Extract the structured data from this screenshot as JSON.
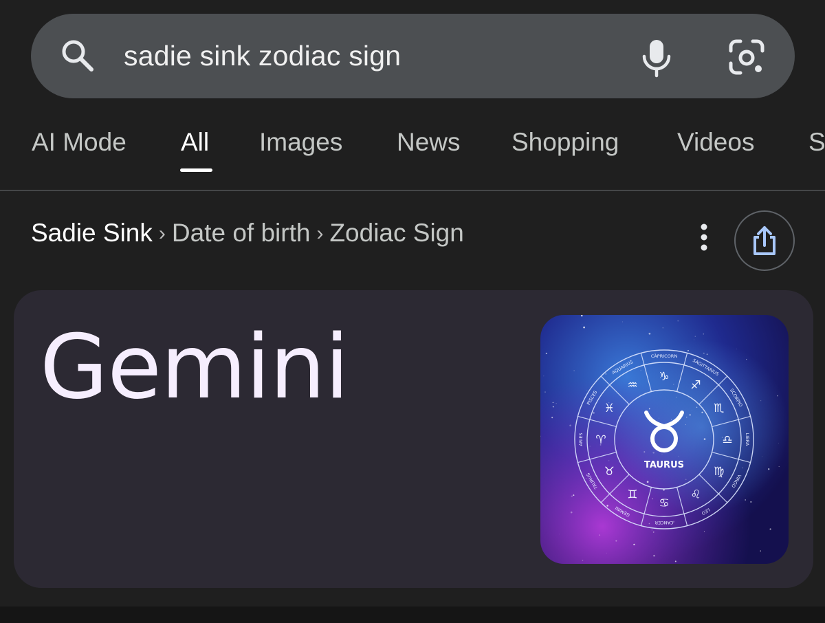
{
  "search": {
    "query": "sadie sink zodiac sign",
    "icons": [
      "search-icon",
      "microphone-icon",
      "camera-lens-icon"
    ]
  },
  "tabs": [
    {
      "label": "AI Mode",
      "active": false
    },
    {
      "label": "All",
      "active": true
    },
    {
      "label": "Images",
      "active": false
    },
    {
      "label": "News",
      "active": false
    },
    {
      "label": "Shopping",
      "active": false
    },
    {
      "label": "Videos",
      "active": false
    },
    {
      "label": "S",
      "active": false
    }
  ],
  "breadcrumb": {
    "entity": "Sadie Sink",
    "separator": "›",
    "step1": "Date of birth",
    "step2": "Zodiac Sign"
  },
  "answer": {
    "value": "Gemini",
    "image": {
      "center_label": "TAURUS",
      "ring_labels": [
        "CAPRICORN",
        "SAGITTARIUS",
        "SCORPIO",
        "LIBRA",
        "VIRGO",
        "LEO",
        "CANCER",
        "GEMINI",
        "TAURUS",
        "ARIES",
        "PISCES",
        "AQUARIUS"
      ],
      "ring_symbols": [
        "♑",
        "♐",
        "♏",
        "♎",
        "♍",
        "♌",
        "♋",
        "♊",
        "♉",
        "♈",
        "♓",
        "♒"
      ]
    }
  },
  "colors": {
    "background": "#1f1f1f",
    "search_bar": "#4c4f52",
    "card": "#2c2933",
    "answer_text": "#f6eefe",
    "share_icon": "#a8c7fa"
  }
}
